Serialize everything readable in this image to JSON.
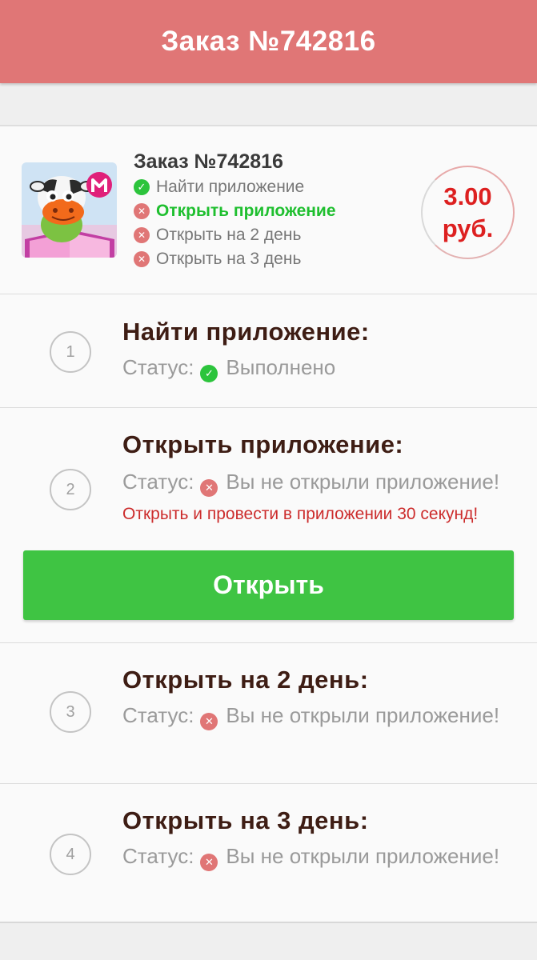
{
  "header": {
    "title": "Заказ №742816"
  },
  "summary": {
    "title": "Заказ №742816",
    "price_line1": "3.00",
    "price_line2": "руб.",
    "tasks": [
      {
        "label": "Найти приложение",
        "state": "done"
      },
      {
        "label": "Открыть приложение",
        "state": "current"
      },
      {
        "label": "Открыть на 2 день",
        "state": "pending"
      },
      {
        "label": "Открыть на 3 день",
        "state": "pending"
      }
    ]
  },
  "status_label": "Статус:",
  "steps": [
    {
      "number": "1",
      "title": "Найти приложение:",
      "status_text": "Выполнено",
      "state": "done"
    },
    {
      "number": "2",
      "title": "Открыть приложение:",
      "status_text": "Вы не открыли приложение!",
      "hint": "Открыть и провести в приложении 30 секунд!",
      "state": "pending"
    },
    {
      "number": "3",
      "title": "Открыть на 2 день:",
      "status_text": "Вы не открыли приложение!",
      "state": "pending"
    },
    {
      "number": "4",
      "title": "Открыть на 3 день:",
      "status_text": "Вы не открыли приложение!",
      "state": "pending"
    }
  ],
  "open_button_label": "Открыть",
  "icons": {
    "done": "check-circle-icon",
    "pending": "cross-circle-icon"
  },
  "colors": {
    "header": "#e07676",
    "success": "#3fc443",
    "error": "#e07676",
    "price": "#dd2020",
    "title": "#3e1d14"
  }
}
